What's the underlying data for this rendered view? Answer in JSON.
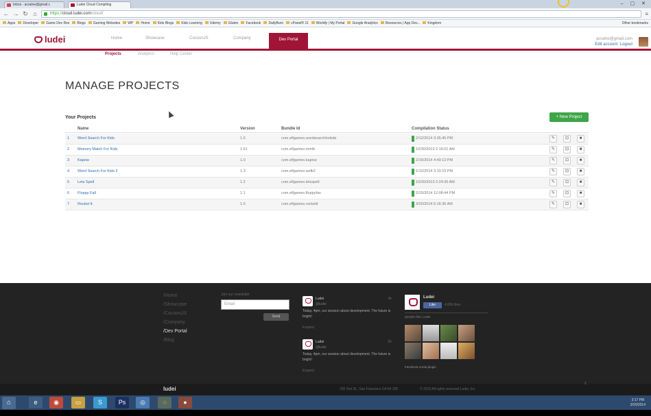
{
  "browser": {
    "tabs": [
      {
        "title": "Inbox - acraine@gmail.c",
        "left": 0
      },
      {
        "title": "Ludei Cloud Compiling",
        "left": 0
      }
    ],
    "url_scheme": "https://",
    "url_domain": "cloud.ludei.com",
    "url_path": "/cloud/",
    "bookmarks": [
      "Apps",
      "Developer",
      "Game Dev Res",
      "Blogs",
      "Gaming Websites",
      "WP",
      "Home",
      "Kids Blogs",
      "Kids Learning",
      "Udemy",
      "Gluten",
      "Facebook",
      "DailyBurn",
      "cPanel® 11",
      "Worldly | My Portal",
      "Google Analytics",
      "Resources | App Dev...",
      "Kingdom"
    ],
    "other_bookmarks": "Other bookmarks"
  },
  "site": {
    "logo_text": "ludei",
    "nav": [
      "Home",
      "Showcase",
      "CocoonJS",
      "Company",
      "Dev Portal"
    ],
    "subnav": [
      "Projects",
      "Analytics",
      "Help Center"
    ],
    "user_email": "acraine@gmail.com",
    "edit_account": "Edit account",
    "logout": "Logout"
  },
  "main": {
    "title": "MANAGE PROJECTS",
    "section_label": "Your Projects",
    "new_project_label": "+ New Project",
    "columns": [
      "Name",
      "Version",
      "Bundle Id",
      "Compilation Status"
    ],
    "projects": [
      {
        "num": "1",
        "name": "Word Search For Kids",
        "version": "1.0",
        "bundle": "com.elfgames.wordsearchforkids",
        "status": "2/12/2014 3:26:45 PM"
      },
      {
        "num": "2",
        "name": "Memory Match For Kids",
        "version": "1.61",
        "bundle": "com.elfgames.mmfk",
        "status": "10/30/2013 2:16:01 AM"
      },
      {
        "num": "3",
        "name": "Kapow",
        "version": "1.0",
        "bundle": "com.elfgames.kapow",
        "status": "2/16/2014 4:49:13 PM"
      },
      {
        "num": "4",
        "name": "Word Search For Kids 2",
        "version": "1.3",
        "bundle": "com.elfgames.wsfk2",
        "status": "1/12/2014 3:10:19 PM"
      },
      {
        "num": "5",
        "name": "Lets Spell",
        "version": "1.2",
        "bundle": "com.elfgames.letsspell",
        "status": "10/30/2013 2:24:35 AM"
      },
      {
        "num": "6",
        "name": "Floppy Fall",
        "version": "1.1",
        "bundle": "com.elfgames.floppyfas",
        "status": "2/15/2014 12:08:44 PM"
      },
      {
        "num": "7",
        "name": "Rocket It",
        "version": "1.0",
        "bundle": "com.elfgames.rocketit",
        "status": "3/20/2014 5:16:36 AM"
      }
    ]
  },
  "footer": {
    "links": [
      "/Home",
      "/Showcase",
      "/CocoonJS",
      "/Company",
      "/Dev Portal",
      "/Blog"
    ],
    "newsletter_label": "Join our newsletter",
    "email_placeholder": "Email",
    "send_label": "Send",
    "tweets": [
      {
        "author": "Ludei",
        "handle": "@ludei",
        "time": "4h",
        "text": "Today, 4pm, our session about development. The future is bright!",
        "expand": "Expand"
      },
      {
        "author": "Ludei",
        "handle": "@ludei",
        "time": "5h",
        "text": "Today, 4pm, our session about development. The future is bright!",
        "expand": "Expand"
      }
    ],
    "fb_name": "Ludei",
    "fb_like": "Like",
    "fb_like_count": "4,656 likes",
    "fb_likers": "people like Ludei",
    "fb_plugin": "Facebook social plugin",
    "address": "100 2nd St., San Francisco CA 94 105",
    "copyright": "© 2013 All rights reserved Ludei, Inc."
  },
  "taskbar": {
    "time": "3:17 PM",
    "date": "3/20/2014"
  },
  "colors": {
    "brand": "#a01535",
    "accent": "#3ea548",
    "link": "#2b6cb0"
  }
}
